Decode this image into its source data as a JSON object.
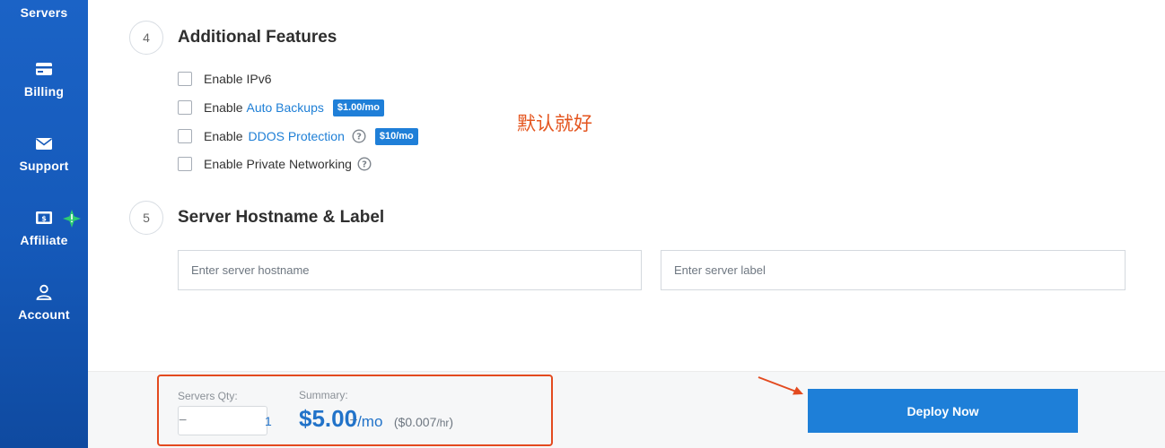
{
  "sidebar": {
    "items": [
      {
        "label": "Servers",
        "icon": "server-icon"
      },
      {
        "label": "Billing",
        "icon": "credit-card-icon"
      },
      {
        "label": "Support",
        "icon": "envelope-icon"
      },
      {
        "label": "Affiliate",
        "icon": "dollar-bill-icon"
      },
      {
        "label": "Account",
        "icon": "user-icon"
      }
    ],
    "affiliate_badge_icon": "sparkle-icon",
    "colors": {
      "background": "#1559b9",
      "text": "#ffffff",
      "badge": "#2ecc71"
    }
  },
  "sections": [
    {
      "step": "4",
      "title": "Additional Features",
      "features": [
        {
          "prefix": "Enable IPv6",
          "link": "",
          "price": "",
          "help": false
        },
        {
          "prefix": "Enable ",
          "link": "Auto Backups",
          "price": "$1.00/mo",
          "help": false
        },
        {
          "prefix": "Enable ",
          "link": "DDOS Protection",
          "price": "$10/mo",
          "help": true
        },
        {
          "prefix": "Enable Private Networking",
          "link": "",
          "price": "",
          "help": true
        }
      ]
    },
    {
      "step": "5",
      "title": "Server Hostname & Label",
      "hostname_placeholder": "Enter server hostname",
      "label_placeholder": "Enter server label",
      "hostname_value": "",
      "label_value": ""
    }
  ],
  "annotation": {
    "note": "默认就好",
    "color": "#e4551f"
  },
  "footer": {
    "qty_label": "Servers Qty:",
    "qty_value": "1",
    "minus": "−",
    "plus": "+",
    "summary_label": "Summary:",
    "price": "$5.00",
    "price_unit": "/mo",
    "hourly_open": "(",
    "hourly_price": "$0.007",
    "hourly_unit": "/hr",
    "hourly_close": ")",
    "deploy_label": "Deploy Now",
    "accent": "#1e7fd8"
  }
}
